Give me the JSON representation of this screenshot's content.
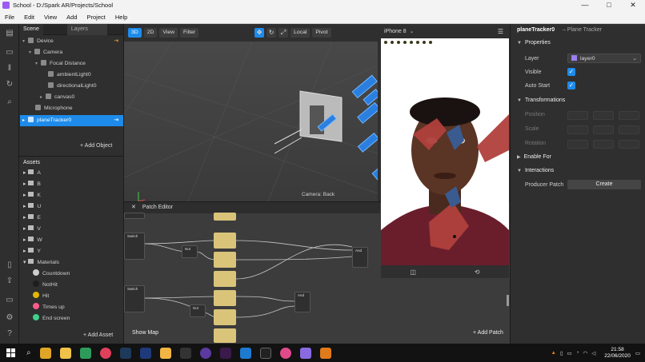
{
  "window": {
    "title": "School - D:/Spark AR/Projects/School",
    "controls": [
      "—",
      "□",
      "✕"
    ]
  },
  "menu": [
    "File",
    "Edit",
    "View",
    "Add",
    "Project",
    "Help"
  ],
  "scene": {
    "tabs": [
      "Scene",
      "Layers"
    ],
    "tree": [
      "Device",
      "Camera",
      "Focal Distance",
      "ambientLight0",
      "directionalLight0",
      "canvas0",
      "Microphone",
      "planeTracker0"
    ],
    "add_object": "+ Add Object"
  },
  "assets": {
    "title": "Assets",
    "folders": [
      "A",
      "B",
      "K",
      "U",
      "E",
      "V",
      "W",
      "Y",
      "Materials"
    ],
    "materials": [
      {
        "name": "Countdown",
        "color": "#cfcfcf"
      },
      {
        "name": "NotHit",
        "color": "#1e1e1e"
      },
      {
        "name": "Hit",
        "color": "#e2b800"
      },
      {
        "name": "Times up",
        "color": "#ff5a8a"
      },
      {
        "name": "End screen",
        "color": "#3fd18a"
      }
    ],
    "add_asset": "+ Add Asset"
  },
  "viewport": {
    "mode_3d": "3D",
    "mode_2d": "2D",
    "view": "View",
    "filter": "Filter",
    "local": "Local",
    "pivot": "Pivot",
    "camera_label": "Camera: Back"
  },
  "patch_editor": {
    "title": "Patch Editor",
    "show_map": "Show Map",
    "add_patch": "+ Add Patch",
    "nodes": [
      "Switch",
      "Switch",
      "Not",
      "Not",
      "And",
      "And"
    ]
  },
  "simulator": {
    "device": "iPhone 8"
  },
  "inspector": {
    "object": "planeTracker0",
    "type": "– Plane Tracker",
    "properties": "Properties",
    "layer_label": "Layer",
    "layer_value": "layer0",
    "visible_label": "Visible",
    "autostart_label": "Auto Start",
    "transformations": "Transformations",
    "position": "Position",
    "scale": "Scale",
    "rotation": "Rotation",
    "enable_for": "Enable For",
    "interactions": "Interactions",
    "producer_patch": "Producer Patch",
    "create": "Create"
  },
  "taskbar": {
    "time": "21:58",
    "date": "22/06/2020"
  }
}
